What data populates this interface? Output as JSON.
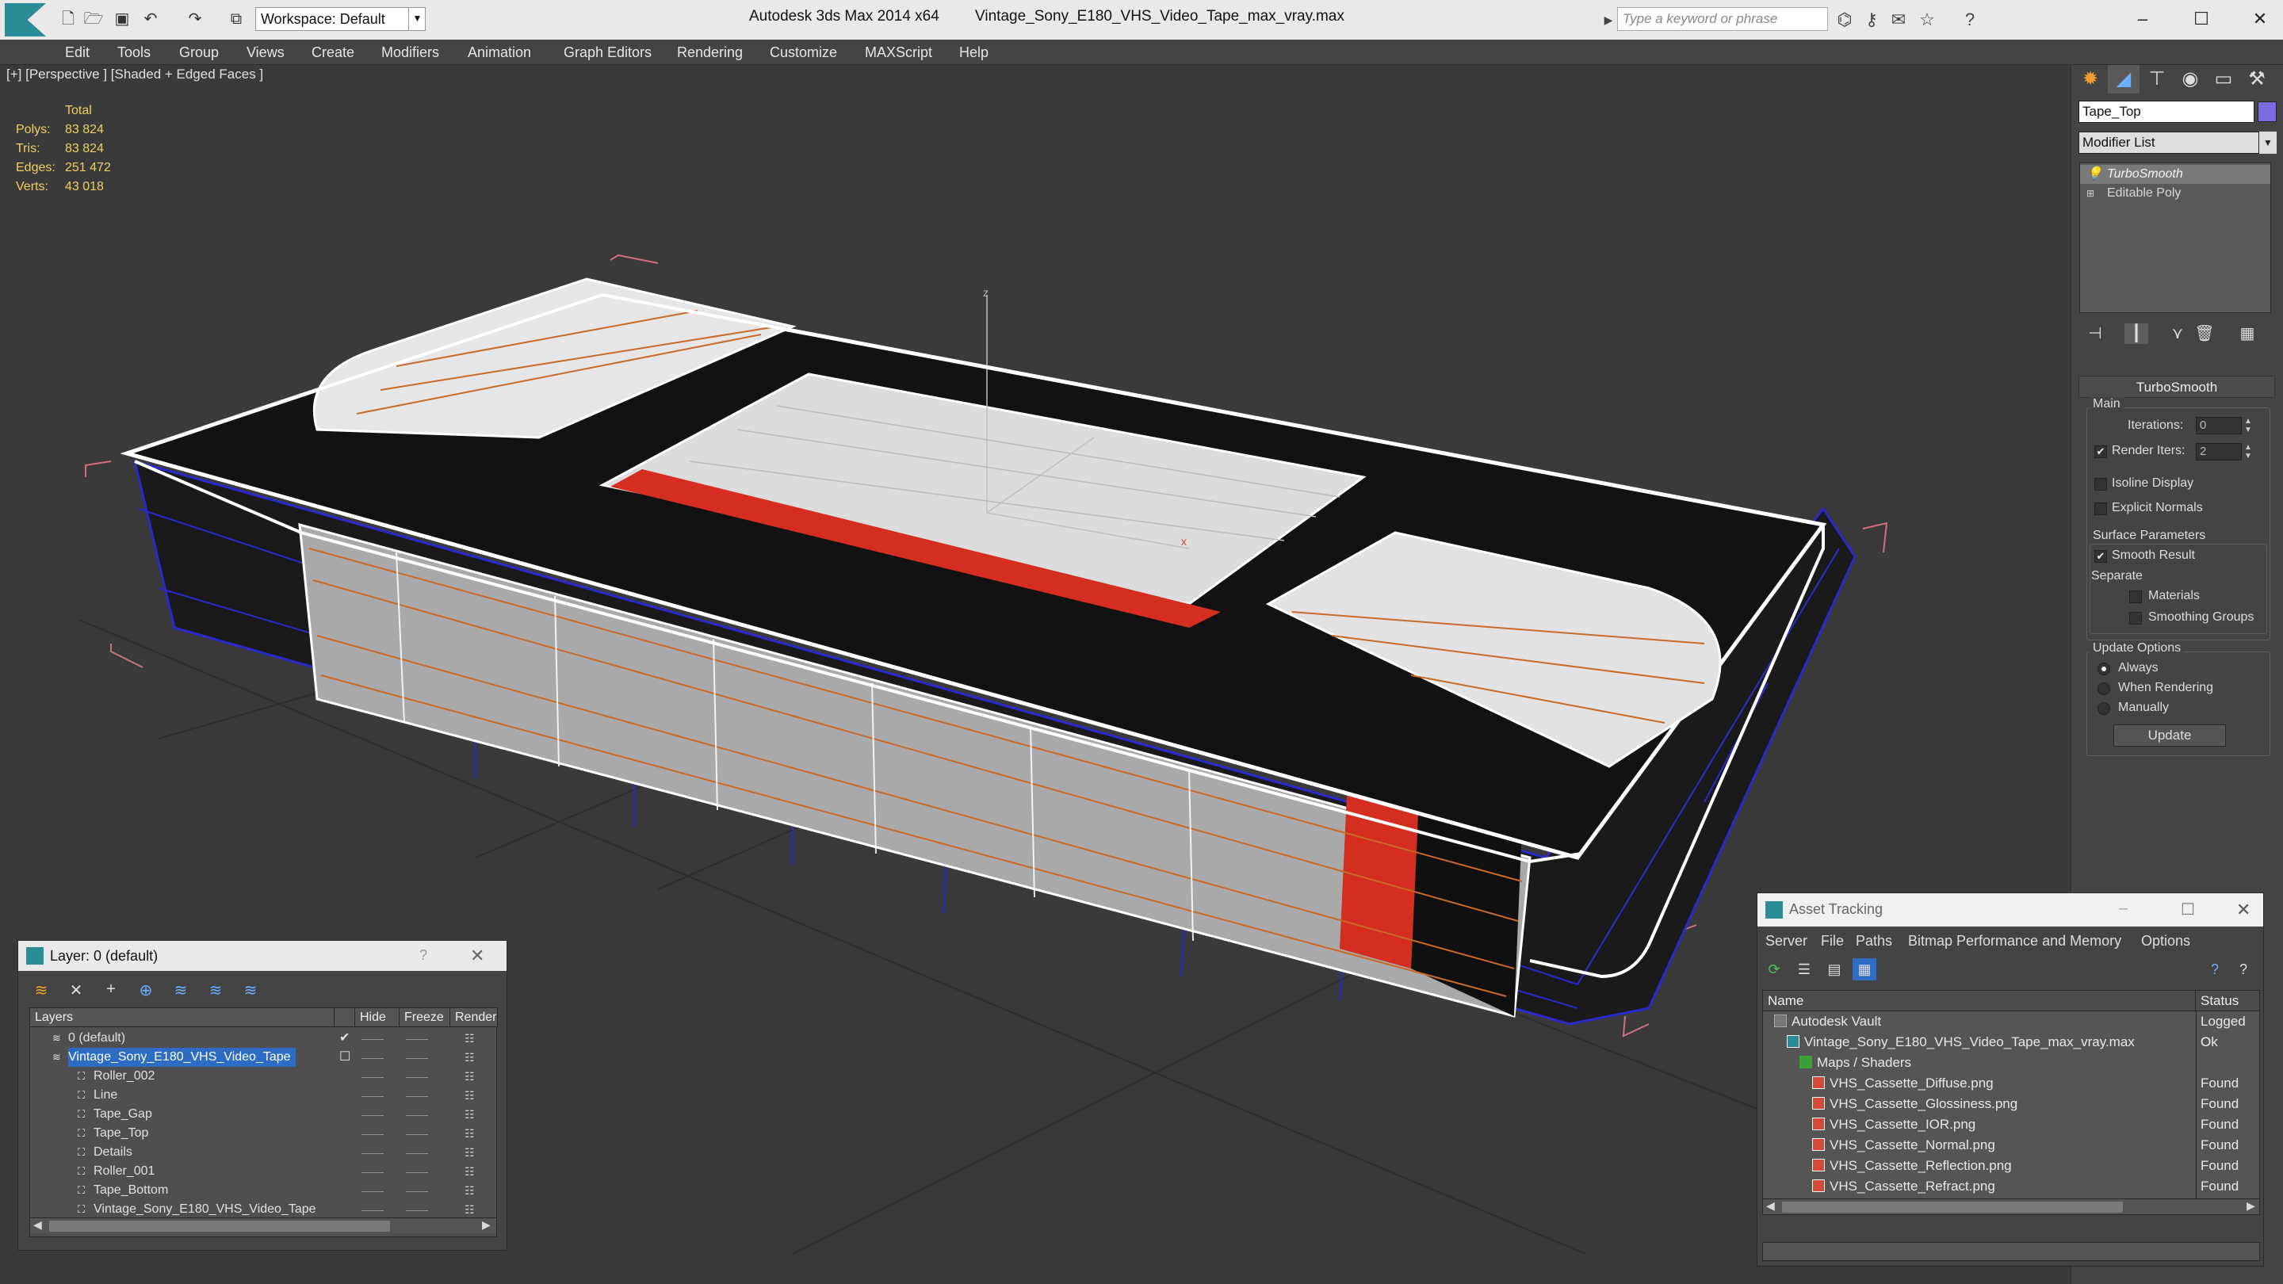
{
  "titlebar": {
    "app_title": "Autodesk 3ds Max  2014 x64",
    "file_title": "Vintage_Sony_E180_VHS_Video_Tape_max_vray.max",
    "workspace": "Workspace: Default",
    "search_placeholder": "Type a keyword or phrase"
  },
  "menu": [
    "Edit",
    "Tools",
    "Group",
    "Views",
    "Create",
    "Modifiers",
    "Animation",
    "Graph Editors",
    "Rendering",
    "Customize",
    "MAXScript",
    "Help"
  ],
  "viewport": {
    "label": "[+] [Perspective ] [Shaded + Edged Faces ]",
    "stats": {
      "total_label": "Total",
      "polys_label": "Polys:",
      "polys": "83 824",
      "tris_label": "Tris:",
      "tris": "83 824",
      "edges_label": "Edges:",
      "edges": "251 472",
      "verts_label": "Verts:",
      "verts": "43 018"
    }
  },
  "command_panel": {
    "object_name": "Tape_Top",
    "object_color": "#7a6be0",
    "modifier_list": "Modifier List",
    "stack": [
      "TurboSmooth",
      "Editable Poly"
    ],
    "rollout": "TurboSmooth",
    "main_group": "Main",
    "iterations_label": "Iterations:",
    "iterations": "0",
    "render_iters_label": "Render Iters:",
    "render_iters": "2",
    "isoline": "Isoline Display",
    "explicit": "Explicit Normals",
    "surface_group": "Surface Parameters",
    "smooth_result": "Smooth Result",
    "separate": "Separate",
    "materials": "Materials",
    "smoothing_groups": "Smoothing Groups",
    "update_group": "Update Options",
    "always": "Always",
    "when_rendering": "When Rendering",
    "manually": "Manually",
    "update_btn": "Update"
  },
  "layer_dialog": {
    "title": "Layer: 0 (default)",
    "help": "?",
    "columns": [
      "Layers",
      "Hide",
      "Freeze",
      "Render"
    ],
    "rows": [
      {
        "name": "0 (default)",
        "indent": 0,
        "selected": false
      },
      {
        "name": "Vintage_Sony_E180_VHS_Video_Tape",
        "indent": 0,
        "selected": true
      },
      {
        "name": "Roller_002",
        "indent": 1,
        "selected": false
      },
      {
        "name": "Line",
        "indent": 1,
        "selected": false
      },
      {
        "name": "Tape_Gap",
        "indent": 1,
        "selected": false
      },
      {
        "name": "Tape_Top",
        "indent": 1,
        "selected": false
      },
      {
        "name": "Details",
        "indent": 1,
        "selected": false
      },
      {
        "name": "Roller_001",
        "indent": 1,
        "selected": false
      },
      {
        "name": "Tape_Bottom",
        "indent": 1,
        "selected": false
      },
      {
        "name": "Vintage_Sony_E180_VHS_Video_Tape",
        "indent": 1,
        "selected": false
      }
    ]
  },
  "asset_dialog": {
    "title": "Asset Tracking",
    "menu": [
      "Server",
      "File",
      "Paths",
      "Bitmap Performance and Memory",
      "Options"
    ],
    "columns": [
      "Name",
      "Status"
    ],
    "rows": [
      {
        "name": "Autodesk Vault",
        "status": "Logged O",
        "indent": 0,
        "kind": "vault"
      },
      {
        "name": "Vintage_Sony_E180_VHS_Video_Tape_max_vray.max",
        "status": "Ok",
        "indent": 1,
        "kind": "max"
      },
      {
        "name": "Maps / Shaders",
        "status": "",
        "indent": 2,
        "kind": "folder"
      },
      {
        "name": "VHS_Cassette_Diffuse.png",
        "status": "Found",
        "indent": 3,
        "kind": "png"
      },
      {
        "name": "VHS_Cassette_Glossiness.png",
        "status": "Found",
        "indent": 3,
        "kind": "png"
      },
      {
        "name": "VHS_Cassette_IOR.png",
        "status": "Found",
        "indent": 3,
        "kind": "png"
      },
      {
        "name": "VHS_Cassette_Normal.png",
        "status": "Found",
        "indent": 3,
        "kind": "png"
      },
      {
        "name": "VHS_Cassette_Reflection.png",
        "status": "Found",
        "indent": 3,
        "kind": "png"
      },
      {
        "name": "VHS_Cassette_Refract.png",
        "status": "Found",
        "indent": 3,
        "kind": "png"
      }
    ]
  }
}
